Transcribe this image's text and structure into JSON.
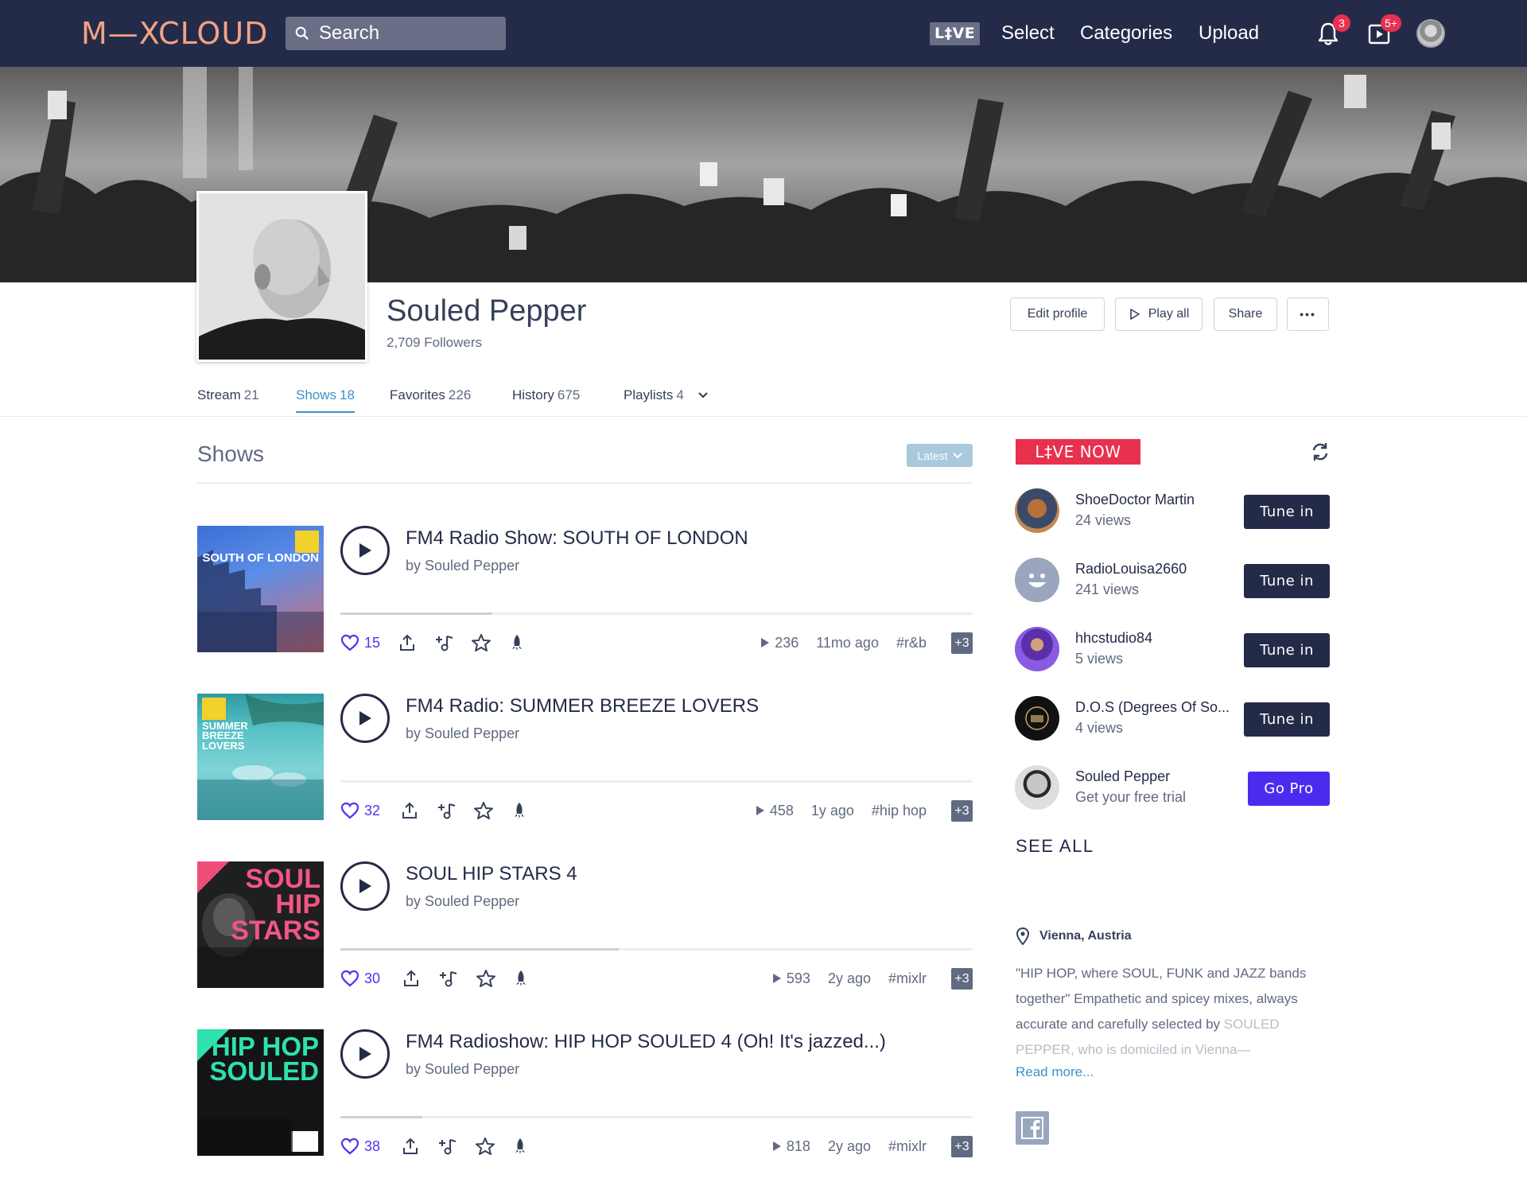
{
  "header": {
    "logo": "M—XCLOUD",
    "search_placeholder": "Search",
    "live_logo": "L‡VE",
    "nav": [
      "Select",
      "Categories",
      "Upload"
    ],
    "notifications_badge": "3",
    "queue_badge": "5+"
  },
  "profile": {
    "name": "Souled Pepper",
    "followers": "2,709 Followers",
    "actions": {
      "edit": "Edit profile",
      "play_all": "Play all",
      "share": "Share",
      "more": "•••"
    },
    "tabs": [
      {
        "label": "Stream",
        "count": "21"
      },
      {
        "label": "Shows",
        "count": "18"
      },
      {
        "label": "Favorites",
        "count": "226"
      },
      {
        "label": "History",
        "count": "675"
      },
      {
        "label": "Playlists",
        "count": "4"
      }
    ]
  },
  "shows_section": {
    "title": "Shows",
    "sort": "Latest",
    "items": [
      {
        "title": "FM4 Radio Show: SOUTH OF LONDON",
        "by": "by Souled Pepper",
        "likes": "15",
        "plays": "236",
        "age": "11mo ago",
        "tag": "#r&b",
        "more_tags": "+3",
        "cover_text": "SOUTH OF LONDON",
        "progress": 0.24
      },
      {
        "title": "FM4 Radio: SUMMER BREEZE LOVERS",
        "by": "by Souled Pepper",
        "likes": "32",
        "plays": "458",
        "age": "1y ago",
        "tag": "#hip hop",
        "more_tags": "+3",
        "cover_text": "SUMMER BREEZE LOVERS",
        "progress": 0.0
      },
      {
        "title": "SOUL HIP STARS 4",
        "by": "by Souled Pepper",
        "likes": "30",
        "plays": "593",
        "age": "2y ago",
        "tag": "#mixlr",
        "more_tags": "+3",
        "cover_text": "SOUL HIP STARS",
        "progress": 0.44
      },
      {
        "title": "FM4 Radioshow: HIP HOP SOULED 4 (Oh! It's jazzed...)",
        "by": "by Souled Pepper",
        "likes": "38",
        "plays": "818",
        "age": "2y ago",
        "tag": "#mixlr",
        "more_tags": "+3",
        "cover_text": "HIP HOP SOULED",
        "progress": 0.13
      }
    ]
  },
  "live_now": {
    "label": "L‡VE NOW",
    "items": [
      {
        "name": "ShoeDoctor Martin",
        "sub": "24 views",
        "button": "Tune in"
      },
      {
        "name": "RadioLouisa2660",
        "sub": "241 views",
        "button": "Tune in"
      },
      {
        "name": "hhcstudio84",
        "sub": "5 views",
        "button": "Tune in"
      },
      {
        "name": "D.O.S (Degrees Of So...",
        "sub": "4 views",
        "button": "Tune in"
      },
      {
        "name": "Souled Pepper",
        "sub": "Get your free trial",
        "button": "Go Pro"
      }
    ],
    "see_all": "SEE ALL"
  },
  "about": {
    "location": "Vienna, Austria",
    "bio": "\"HIP HOP, where SOUL, FUNK and JAZZ bands together\" Empathetic and spicey mixes, always accurate and carefully selected by",
    "bio_fade": "SOULED PEPPER, who is domiciled in Vienna—",
    "read_more": "Read more..."
  },
  "colors": {
    "topbar": "#242b48",
    "accent_blue": "#3b93c9",
    "like_purple": "#4a37ed",
    "live_red": "#e8304f",
    "go_pro": "#4a2cf0"
  }
}
